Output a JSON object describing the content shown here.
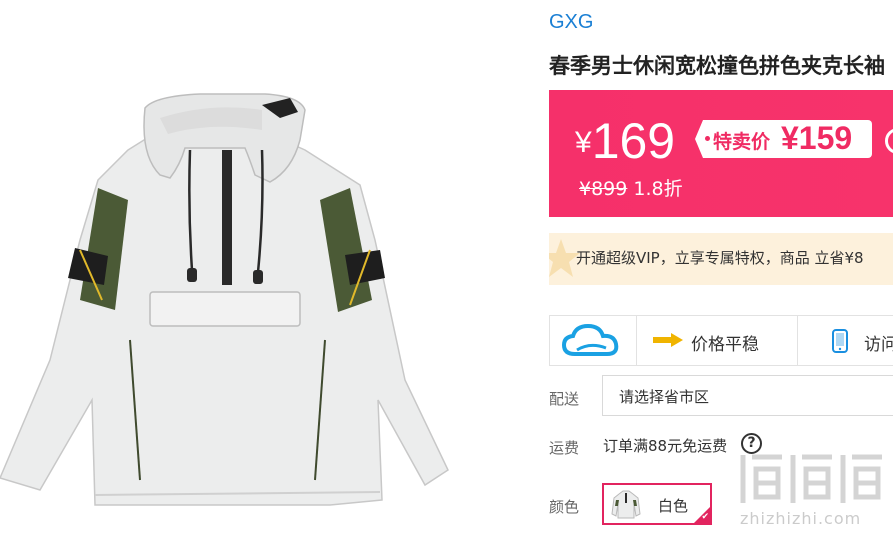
{
  "brand": "GXG",
  "title": "春季男士休闲宽松撞色拼色夹克长袖",
  "price": {
    "currency": "¥",
    "current": "169",
    "special_label": "特卖价",
    "special_price": "¥159",
    "original": "¥899",
    "discount": "1.8折"
  },
  "vip": {
    "text": "开通超级VIP，立享专属特权，商品 立省¥8"
  },
  "tags": {
    "stable_label": "价格平稳",
    "visit_label": "访问"
  },
  "shipping": {
    "label": "配送",
    "placeholder": "请选择省市区"
  },
  "fee": {
    "label": "运费",
    "text": "订单满88元免运费",
    "help": "?"
  },
  "color": {
    "label": "颜色",
    "selected": "白色"
  },
  "watermark": {
    "url": "zhizhizhi.com"
  },
  "colors": {
    "accent": "#f5306a",
    "brand": "#1a7fd4",
    "vip_bg": "#fdf1dc"
  },
  "icons": [
    "cloud-icon",
    "arrow-right-icon",
    "phone-icon",
    "help-icon",
    "check-icon",
    "share-icon"
  ]
}
